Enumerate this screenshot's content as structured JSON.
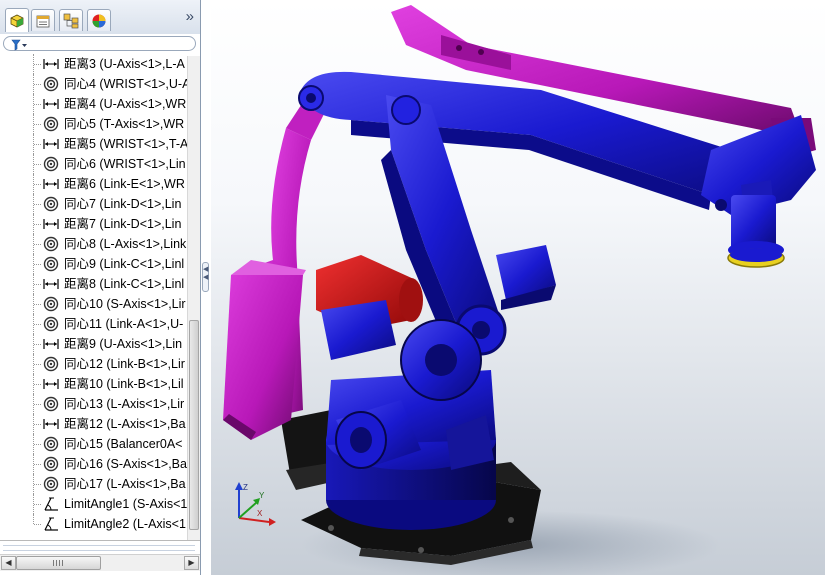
{
  "tabs": [
    {
      "icon": "feature-manager-icon",
      "active": true
    },
    {
      "icon": "property-manager-icon",
      "active": false
    },
    {
      "icon": "configuration-manager-icon",
      "active": false
    },
    {
      "icon": "display-manager-icon",
      "active": false
    }
  ],
  "tab_overflow": "»",
  "filter_icon": "filter-icon",
  "tree_items": [
    {
      "icon": "distance-mate-icon",
      "label": "距离3 (U-Axis<1>,L-A"
    },
    {
      "icon": "concentric-mate-icon",
      "label": "同心4 (WRIST<1>,U-A"
    },
    {
      "icon": "distance-mate-icon",
      "label": "距离4 (U-Axis<1>,WR"
    },
    {
      "icon": "concentric-mate-icon",
      "label": "同心5 (T-Axis<1>,WR"
    },
    {
      "icon": "distance-mate-icon",
      "label": "距离5 (WRIST<1>,T-A"
    },
    {
      "icon": "concentric-mate-icon",
      "label": "同心6 (WRIST<1>,Lin"
    },
    {
      "icon": "distance-mate-icon",
      "label": "距离6 (Link-E<1>,WR"
    },
    {
      "icon": "concentric-mate-icon",
      "label": "同心7 (Link-D<1>,Lin"
    },
    {
      "icon": "distance-mate-icon",
      "label": "距离7 (Link-D<1>,Lin"
    },
    {
      "icon": "concentric-mate-icon",
      "label": "同心8 (L-Axis<1>,Link"
    },
    {
      "icon": "concentric-mate-icon",
      "label": "同心9 (Link-C<1>,Linl"
    },
    {
      "icon": "distance-mate-icon",
      "label": "距离8 (Link-C<1>,Linl"
    },
    {
      "icon": "concentric-mate-icon",
      "label": "同心10 (S-Axis<1>,Lir"
    },
    {
      "icon": "concentric-mate-icon",
      "label": "同心11 (Link-A<1>,U-"
    },
    {
      "icon": "distance-mate-icon",
      "label": "距离9 (U-Axis<1>,Lin"
    },
    {
      "icon": "concentric-mate-icon",
      "label": "同心12 (Link-B<1>,Lir"
    },
    {
      "icon": "distance-mate-icon",
      "label": "距离10 (Link-B<1>,Lil"
    },
    {
      "icon": "concentric-mate-icon",
      "label": "同心13 (L-Axis<1>,Lir"
    },
    {
      "icon": "distance-mate-icon",
      "label": "距离12 (L-Axis<1>,Ba"
    },
    {
      "icon": "concentric-mate-icon",
      "label": "同心15 (Balancer0A<"
    },
    {
      "icon": "concentric-mate-icon",
      "label": "同心16 (S-Axis<1>,Ba"
    },
    {
      "icon": "concentric-mate-icon",
      "label": "同心17 (L-Axis<1>,Ba"
    },
    {
      "icon": "limit-angle-mate-icon",
      "label": "LimitAngle1 (S-Axis<1"
    },
    {
      "icon": "limit-angle-mate-icon",
      "label": "LimitAngle2 (L-Axis<1"
    }
  ],
  "triad": {
    "x": "X",
    "y": "Y",
    "z": "Z"
  },
  "colors": {
    "robot_blue": "#1a1ad0",
    "linkage_magenta": "#c21ec2",
    "cylinder_red": "#d81818",
    "base_black": "#111111",
    "flange_yellow": "#e8d020"
  }
}
